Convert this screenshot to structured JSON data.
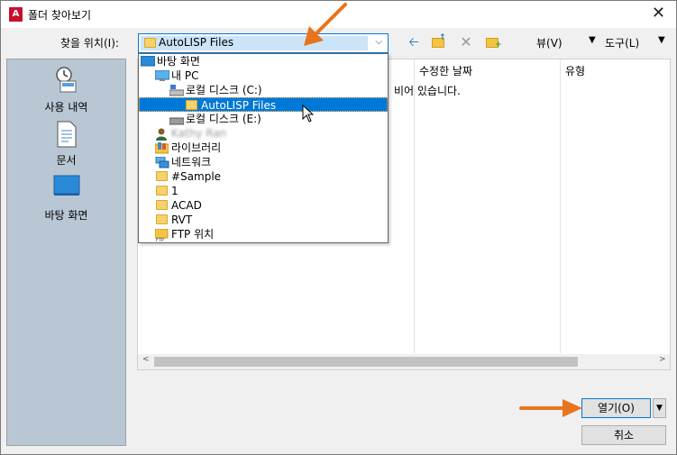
{
  "window": {
    "title": "폴더 찾아보기",
    "app_icon_letter": "A",
    "close_glyph": "✕"
  },
  "toolbar": {
    "look_in_label": "찾을 위치(I):",
    "look_in_value": "AutoLISP Files",
    "views_label": "뷰(V)",
    "tools_label": "도구(L)"
  },
  "places": [
    {
      "label": "사용 내역",
      "icon": "history-icon"
    },
    {
      "label": "문서",
      "icon": "documents-icon"
    },
    {
      "label": "바탕 화면",
      "icon": "desktop-icon"
    }
  ],
  "list": {
    "columns": [
      "수정한 날짜",
      "유형"
    ],
    "empty_message": "비어 있습니다."
  },
  "dropdown_items": [
    {
      "label": "바탕 화면",
      "icon": "desktop-icon",
      "indent": 0,
      "selected": false
    },
    {
      "label": "내 PC",
      "icon": "pc-icon",
      "indent": 1,
      "selected": false
    },
    {
      "label": "로컬 디스크 (C:)",
      "icon": "drive-icon",
      "indent": 2,
      "selected": false
    },
    {
      "label": "AutoLISP Files",
      "icon": "folder-icon",
      "indent": 3,
      "selected": true
    },
    {
      "label": "로컬 디스크 (E:)",
      "icon": "drive-icon",
      "indent": 2,
      "selected": false
    },
    {
      "label": "Kathy Ran",
      "icon": "user-icon",
      "indent": 1,
      "selected": false,
      "blurred": true
    },
    {
      "label": "라이브러리",
      "icon": "library-icon",
      "indent": 1,
      "selected": false
    },
    {
      "label": "네트워크",
      "icon": "network-icon",
      "indent": 1,
      "selected": false
    },
    {
      "label": "#Sample",
      "icon": "folder-icon",
      "indent": 1,
      "selected": false
    },
    {
      "label": "1",
      "icon": "folder-icon",
      "indent": 1,
      "selected": false
    },
    {
      "label": "ACAD",
      "icon": "folder-icon",
      "indent": 1,
      "selected": false
    },
    {
      "label": "RVT",
      "icon": "folder-icon",
      "indent": 1,
      "selected": false
    },
    {
      "label": "FTP 위치",
      "icon": "ftp-icon",
      "indent": 1,
      "selected": false
    }
  ],
  "buttons": {
    "open": "열기(O)",
    "cancel": "취소"
  },
  "colors": {
    "accent": "#0078d7",
    "annotation_arrow": "#e8741d",
    "places_bg": "#b9c7d5"
  }
}
